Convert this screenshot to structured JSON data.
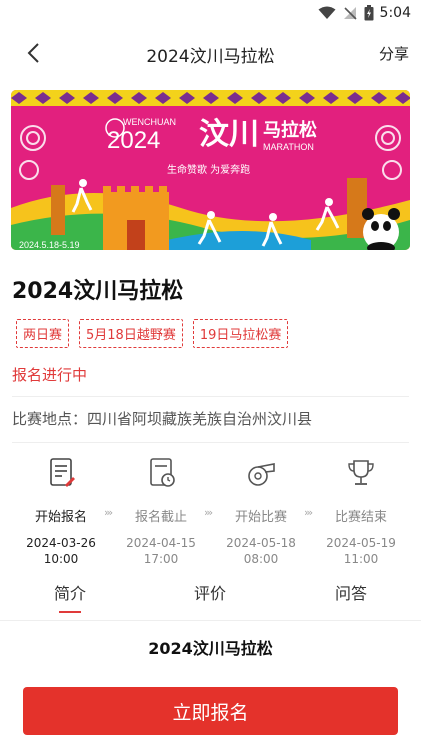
{
  "status_bar": {
    "time": "5:04"
  },
  "nav": {
    "title": "2024汶川马拉松",
    "share": "分享"
  },
  "banner": {
    "sub_en": "WENCHUAN",
    "year": "2024",
    "title_cn": "汶川",
    "title_cn2": "马拉松",
    "title_en": "MARATHON",
    "slogan": "生命赞歌 为爱奔跑",
    "date_range": "2024.5.18-5.19"
  },
  "event": {
    "title": "2024汶川马拉松",
    "tags": [
      "两日赛",
      "5月18日越野赛",
      "19日马拉松赛"
    ],
    "status": "报名进行中",
    "location": "比赛地点：四川省阿坝藏族羌族自治州汶川县"
  },
  "timeline": [
    {
      "label": "开始报名",
      "date": "2024-03-26",
      "time": "10:00",
      "icon": "form-icon"
    },
    {
      "label": "报名截止",
      "date": "2024-04-15",
      "time": "17:00",
      "icon": "deadline-icon"
    },
    {
      "label": "开始比赛",
      "date": "2024-05-18",
      "time": "08:00",
      "icon": "whistle-icon"
    },
    {
      "label": "比赛结束",
      "date": "2024-05-19",
      "time": "11:00",
      "icon": "trophy-icon"
    }
  ],
  "tabs": [
    "简介",
    "评价",
    "问答"
  ],
  "intro": {
    "heading": "2024汶川马拉松"
  },
  "cta": {
    "label": "立即报名"
  },
  "colors": {
    "accent": "#e4322b",
    "banner_bg": "#e2207e"
  }
}
